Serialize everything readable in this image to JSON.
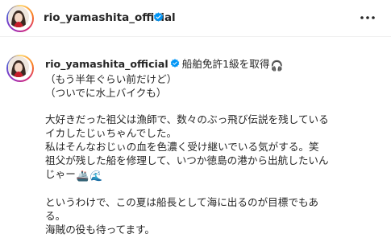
{
  "header": {
    "username": "rio_yamashita_official",
    "more_icon": "more-horizontal-icon",
    "verified_icon": "verified-badge-icon"
  },
  "post": {
    "username": "rio_yamashita_official",
    "lines": [
      "船舶免許1級を取得",
      "（もう半年ぐらい前だけど）",
      "（ついでに水上バイクも）",
      "",
      "大好きだった祖父は漁師で、数々のぶっ飛び伝説を残している",
      "イカしたじぃちゃんでした。",
      "私はそんなおじぃの血を色濃く受け継いでいる気がする。笑",
      "祖父が残した船を修理して、いつか徳島の港から出航したいん",
      "じゃー",
      "",
      "というわけで、この夏は船長として海に出るのが目標でもあ",
      "る。",
      "海賊の役も待ってます。"
    ],
    "emojis": {
      "headphones": "🎧",
      "ship": "🚢",
      "wave": "🌊"
    }
  },
  "colors": {
    "verified_blue": "#0095f6",
    "text": "#262626"
  }
}
